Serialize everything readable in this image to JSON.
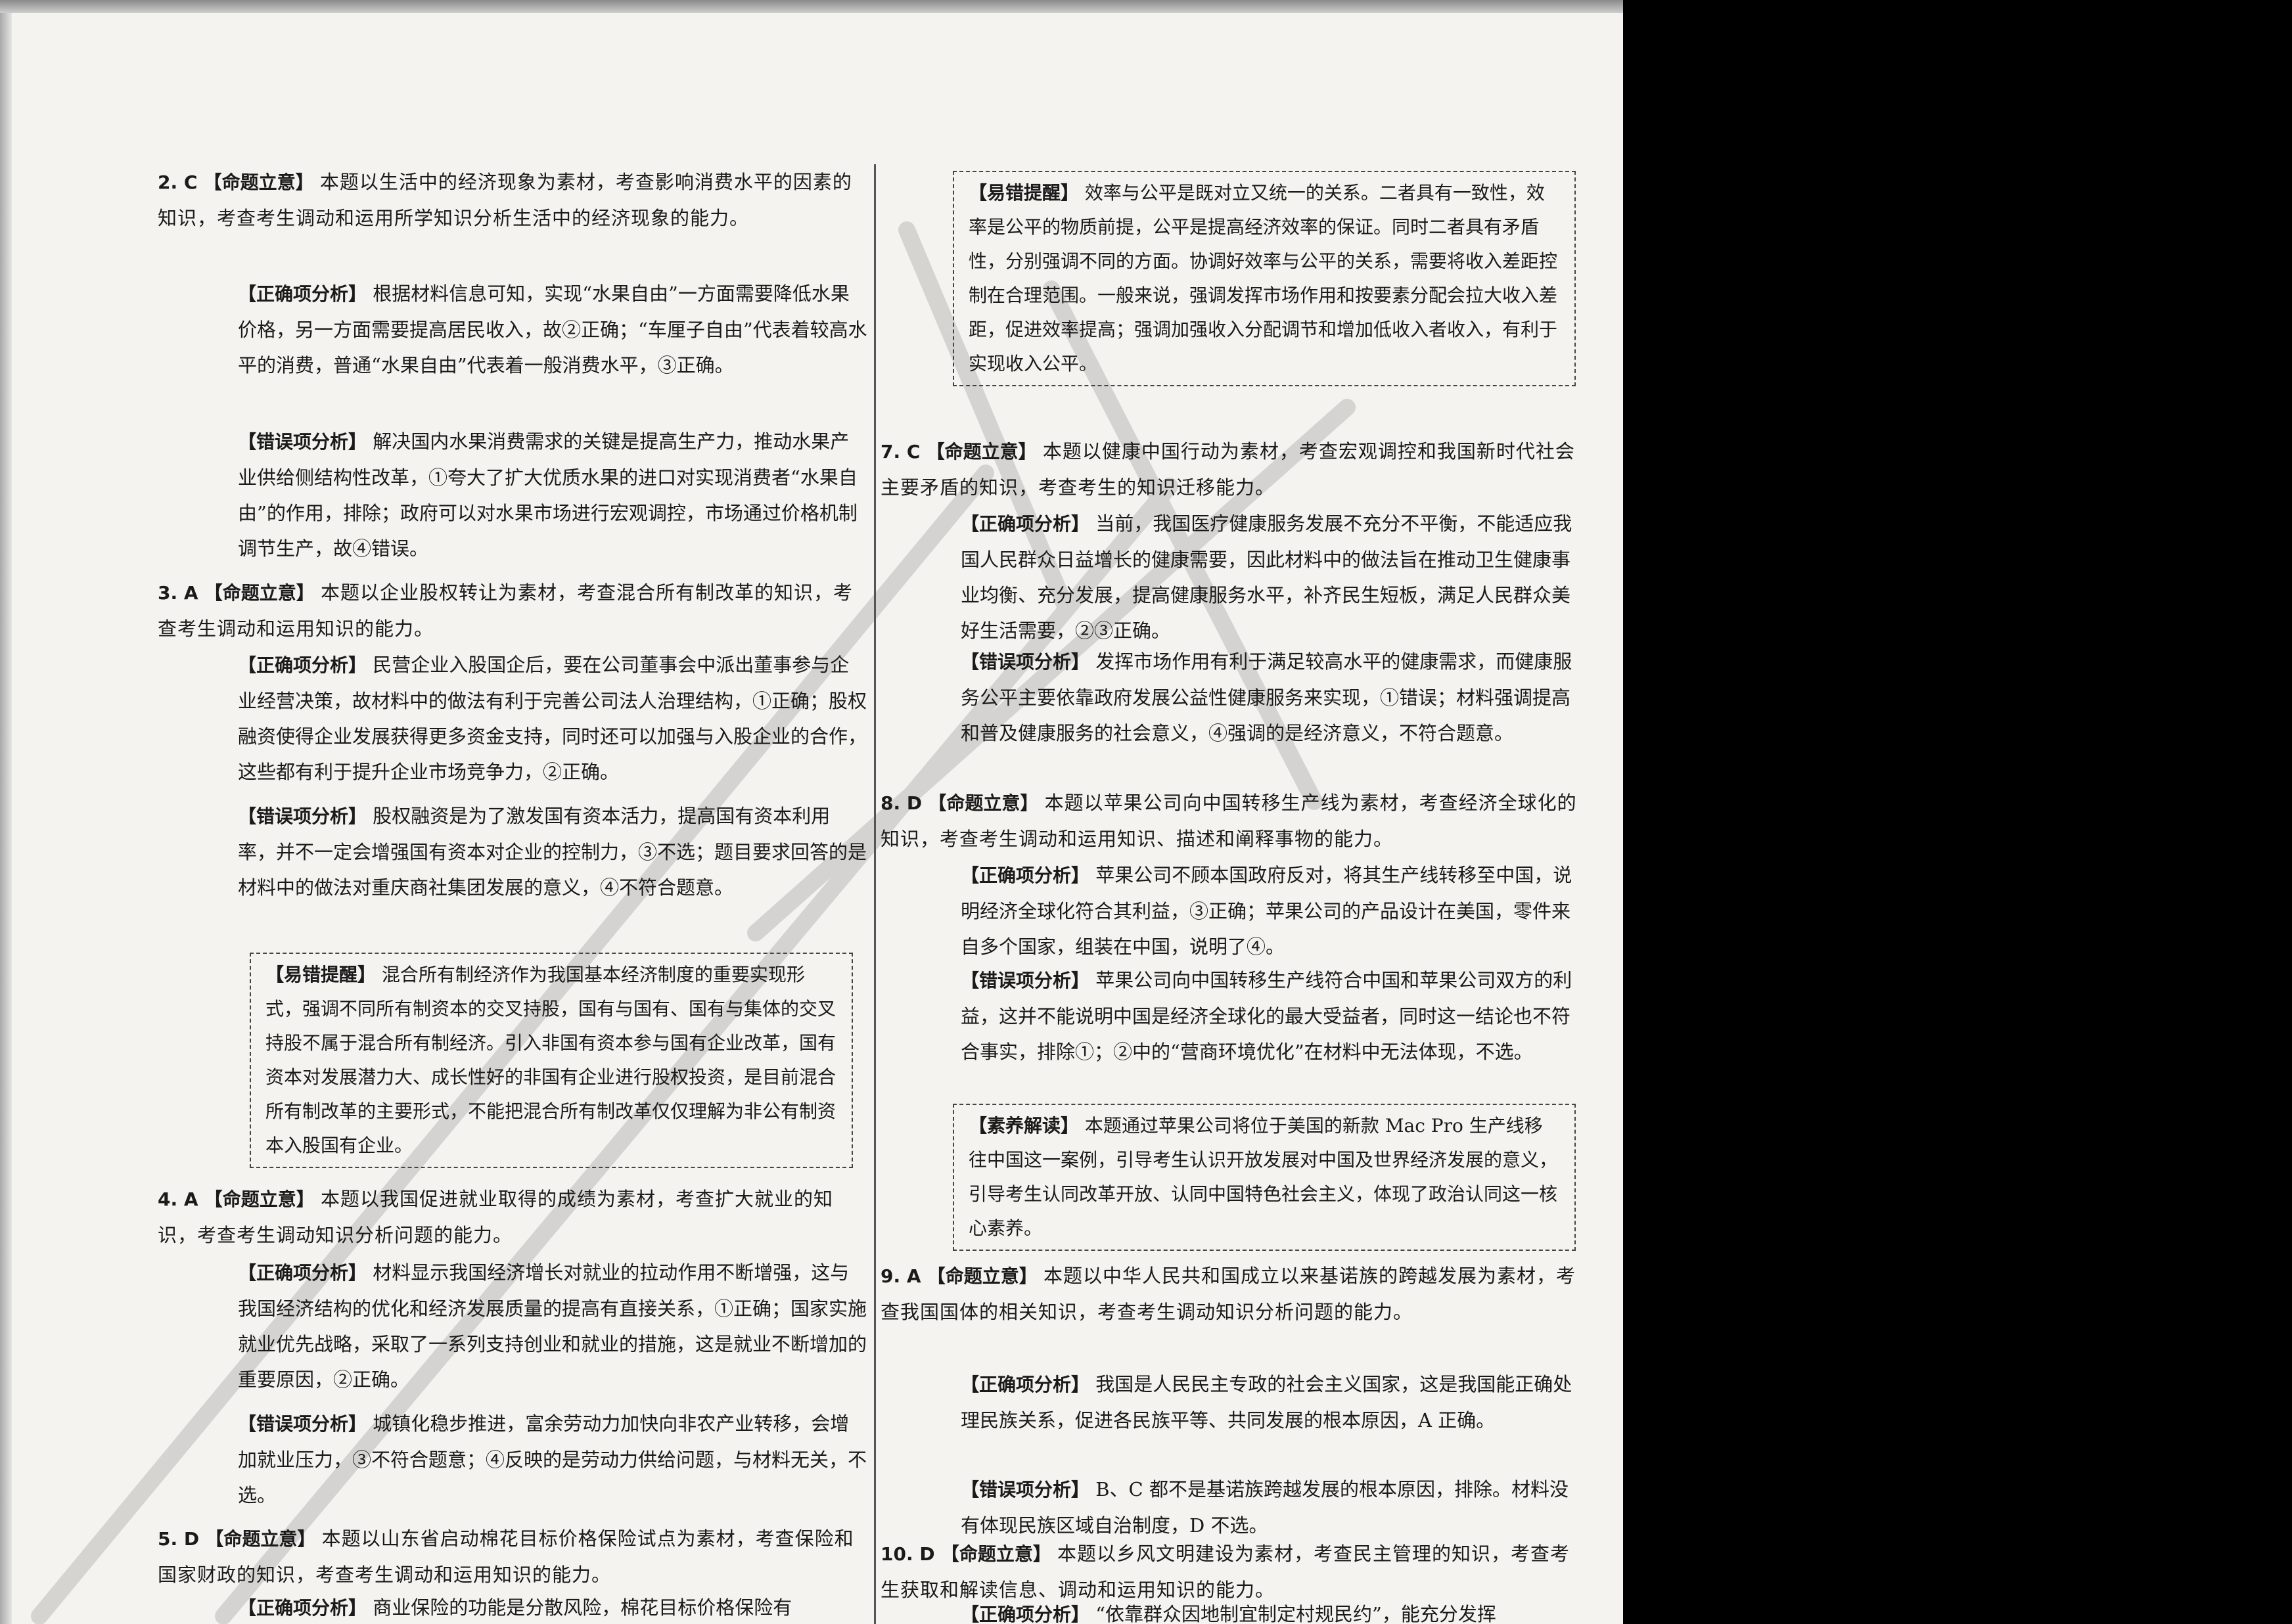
{
  "left_column": {
    "q2": {
      "number": "2. C",
      "intent_tag": "【命题立意】",
      "intent": "本题以生活中的经济现象为素材，考查影响消费水平的因素的知识，考查考生调动和运用所学知识分析生活中的经济现象的能力。",
      "correct_tag": "【正确项分析】",
      "correct": "根据材料信息可知，实现“水果自由”一方面需要降低水果价格，另一方面需要提高居民收入，故②正确；“车厘子自由”代表着较高水平的消费，普通“水果自由”代表着一般消费水平，③正确。",
      "wrong_tag": "【错误项分析】",
      "wrong": "解决国内水果消费需求的关键是提高生产力，推动水果产业供给侧结构性改革，①夸大了扩大优质水果的进口对实现消费者“水果自由”的作用，排除；政府可以对水果市场进行宏观调控，市场通过价格机制调节生产，故④错误。"
    },
    "q3": {
      "number": "3. A",
      "intent_tag": "【命题立意】",
      "intent": "本题以企业股权转让为素材，考查混合所有制改革的知识，考查考生调动和运用知识的能力。",
      "correct_tag": "【正确项分析】",
      "correct": "民营企业入股国企后，要在公司董事会中派出董事参与企业经营决策，故材料中的做法有利于完善公司法人治理结构，①正确；股权融资使得企业发展获得更多资金支持，同时还可以加强与入股企业的合作，这些都有利于提升企业市场竞争力，②正确。",
      "wrong_tag": "【错误项分析】",
      "wrong": "股权融资是为了激发国有资本活力，提高国有资本利用率，并不一定会增强国有资本对企业的控制力，③不选；题目要求回答的是材料中的做法对重庆商社集团发展的意义，④不符合题意。",
      "reminder_tag": "【易错提醒】",
      "reminder": "混合所有制经济作为我国基本经济制度的重要实现形式，强调不同所有制资本的交叉持股，国有与国有、国有与集体的交叉持股不属于混合所有制经济。引入非国有资本参与国有企业改革，国有资本对发展潜力大、成长性好的非国有企业进行股权投资，是目前混合所有制改革的主要形式，不能把混合所有制改革仅仅理解为非公有制资本入股国有企业。"
    },
    "q4": {
      "number": "4. A",
      "intent_tag": "【命题立意】",
      "intent": "本题以我国促进就业取得的成绩为素材，考查扩大就业的知识，考查考生调动知识分析问题的能力。",
      "correct_tag": "【正确项分析】",
      "correct": "材料显示我国经济增长对就业的拉动作用不断增强，这与我国经济结构的优化和经济发展质量的提高有直接关系，①正确；国家实施就业优先战略，采取了一系列支持创业和就业的措施，这是就业不断增加的重要原因，②正确。",
      "wrong_tag": "【错误项分析】",
      "wrong": "城镇化稳步推进，富余劳动力加快向非农产业转移，会增加就业压力，③不符合题意；④反映的是劳动力供给问题，与材料无关，不选。"
    },
    "q5": {
      "number": "5. D",
      "intent_tag": "【命题立意】",
      "intent": "本题以山东省启动棉花目标价格保险试点为素材，考查保险和国家财政的知识，考查考生调动和运用知识的能力。",
      "correct_tag": "【正确项分析】",
      "correct": "商业保险的功能是分散风险，棉花目标价格保险有"
    }
  },
  "right_column": {
    "q6_reminder": {
      "reminder_tag": "【易错提醒】",
      "reminder": "效率与公平是既对立又统一的关系。二者具有一致性，效率是公平的物质前提，公平是提高经济效率的保证。同时二者具有矛盾性，分别强调不同的方面。协调好效率与公平的关系，需要将收入差距控制在合理范围。一般来说，强调发挥市场作用和按要素分配会拉大收入差距，促进效率提高；强调加强收入分配调节和增加低收入者收入，有利于实现收入公平。"
    },
    "q7": {
      "number": "7. C",
      "intent_tag": "【命题立意】",
      "intent": "本题以健康中国行动为素材，考查宏观调控和我国新时代社会主要矛盾的知识，考查考生的知识迁移能力。",
      "correct_tag": "【正确项分析】",
      "correct": "当前，我国医疗健康服务发展不充分不平衡，不能适应我国人民群众日益增长的健康需要，因此材料中的做法旨在推动卫生健康事业均衡、充分发展，提高健康服务水平，补齐民生短板，满足人民群众美好生活需要，②③正确。",
      "wrong_tag": "【错误项分析】",
      "wrong": "发挥市场作用有利于满足较高水平的健康需求，而健康服务公平主要依靠政府发展公益性健康服务来实现，①错误；材料强调提高和普及健康服务的社会意义，④强调的是经济意义，不符合题意。"
    },
    "q8": {
      "number": "8. D",
      "intent_tag": "【命题立意】",
      "intent": "本题以苹果公司向中国转移生产线为素材，考查经济全球化的知识，考查考生调动和运用知识、描述和阐释事物的能力。",
      "correct_tag": "【正确项分析】",
      "correct": "苹果公司不顾本国政府反对，将其生产线转移至中国，说明经济全球化符合其利益，③正确；苹果公司的产品设计在美国，零件来自多个国家，组装在中国，说明了④。",
      "wrong_tag": "【错误项分析】",
      "wrong": "苹果公司向中国转移生产线符合中国和苹果公司双方的利益，这并不能说明中国是经济全球化的最大受益者，同时这一结论也不符合事实，排除①；②中的“营商环境优化”在材料中无法体现，不选。",
      "literacy_tag": "【素养解读】",
      "literacy": "本题通过苹果公司将位于美国的新款 Mac Pro 生产线移往中国这一案例，引导考生认识开放发展对中国及世界经济发展的意义，引导考生认同改革开放、认同中国特色社会主义，体现了政治认同这一核心素养。"
    },
    "q9": {
      "number": "9. A",
      "intent_tag": "【命题立意】",
      "intent": "本题以中华人民共和国成立以来基诺族的跨越发展为素材，考查我国国体的相关知识，考查考生调动知识分析问题的能力。",
      "correct_tag": "【正确项分析】",
      "correct": "我国是人民民主专政的社会主义国家，这是我国能正确处理民族关系，促进各民族平等、共同发展的根本原因，A 正确。",
      "wrong_tag": "【错误项分析】",
      "wrong": "B、C 都不是基诺族跨越发展的根本原因，排除。材料没有体现民族区域自治制度，D 不选。"
    },
    "q10": {
      "number": "10. D",
      "intent_tag": "【命题立意】",
      "intent": "本题以乡风文明建设为素材，考查民主管理的知识，考查考生获取和解读信息、调动和运用知识的能力。",
      "correct_tag": "【正确项分析】",
      "correct": "“依靠群众因地制宜制定村规民约”，能充分发挥"
    }
  }
}
